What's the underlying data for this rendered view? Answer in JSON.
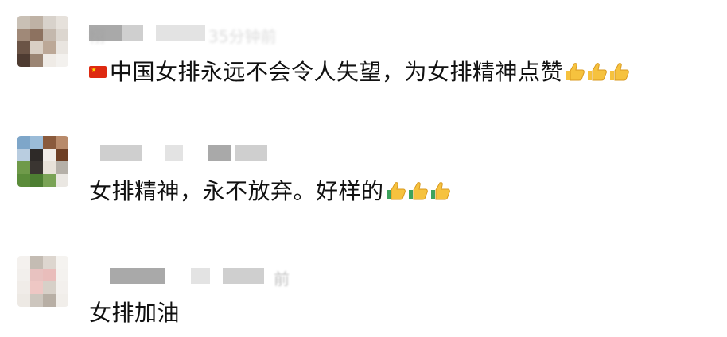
{
  "comments": [
    {
      "user": "栩",
      "time": "35分钟前",
      "text": "中国女排永远不会令人失望，为女排精神点赞",
      "emoji_prefix": "china-flag",
      "emoji_suffix": "thumbs-up-x3"
    },
    {
      "user": "",
      "time": "",
      "text": "女排精神，永不放弃。好样的",
      "emoji_suffix": "thumbs-up-x3"
    },
    {
      "user": "",
      "time": "前",
      "text": "女排加油"
    }
  ],
  "colors": {
    "text": "#111111",
    "meta": "#9a9a9a",
    "flag_red": "#de2910",
    "flag_star": "#ffde00",
    "thumb_yellow": "#f6c23e",
    "thumb_green": "#3da35d"
  }
}
